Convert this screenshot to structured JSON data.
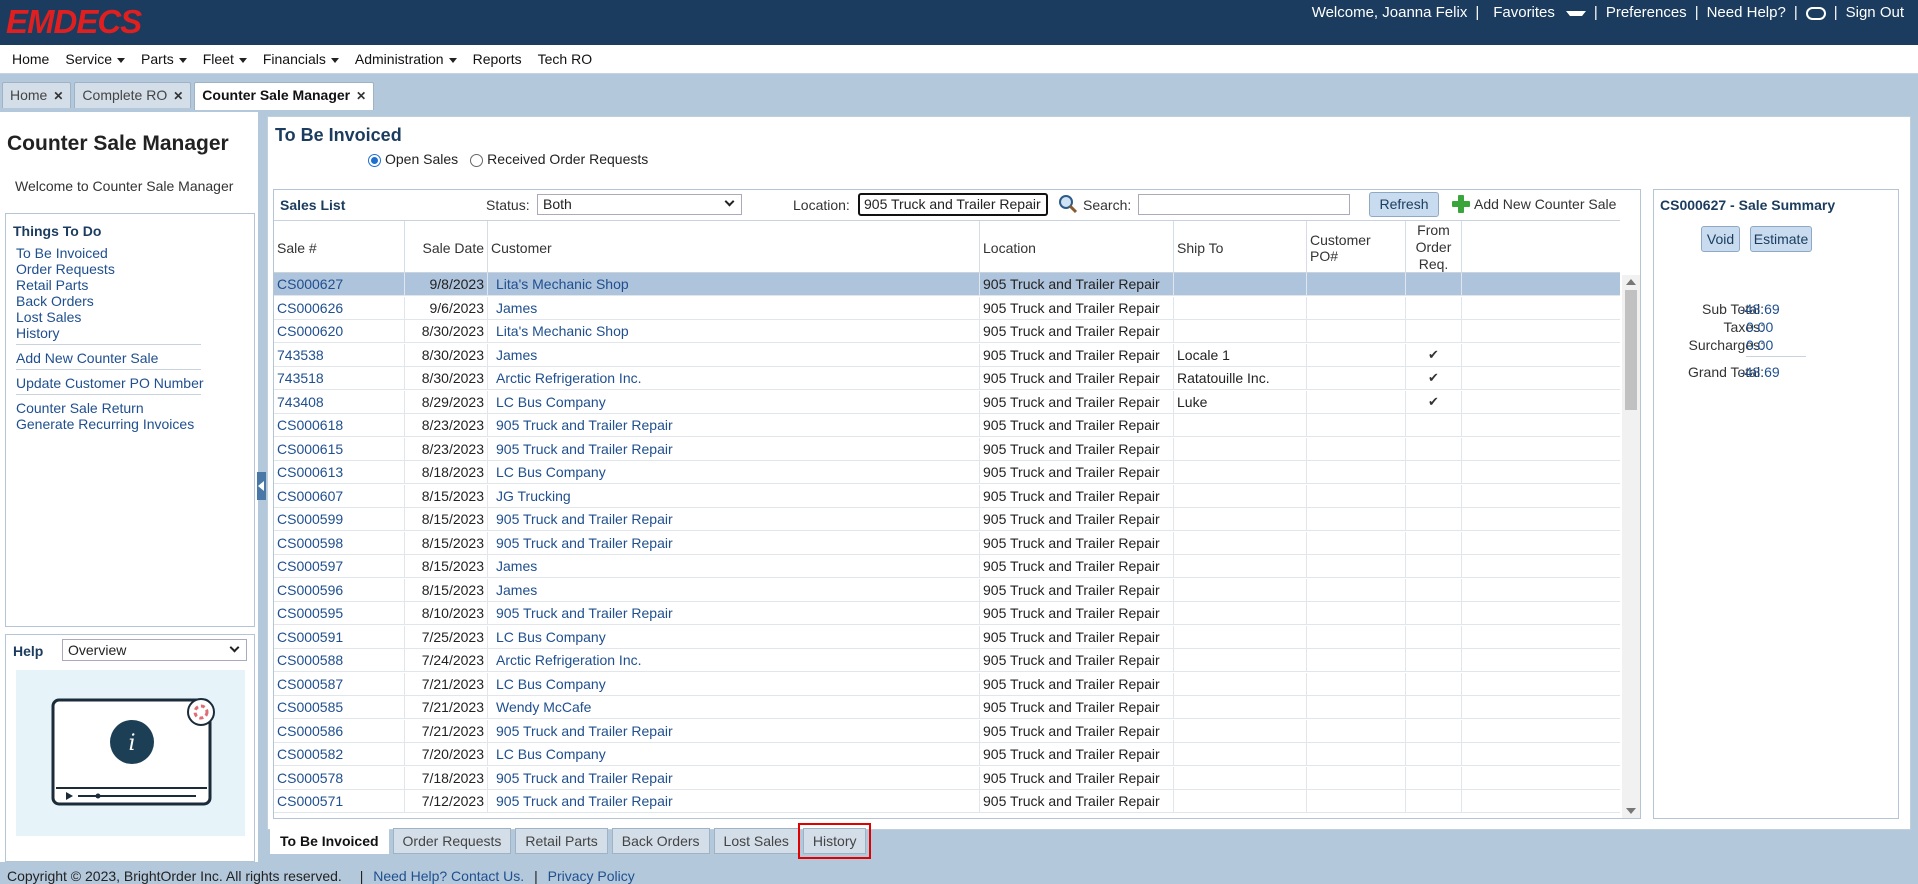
{
  "header": {
    "logo": "EMDECS",
    "welcome": "Welcome, Joanna Felix",
    "favorites": "Favorites",
    "preferences": "Preferences",
    "need_help": "Need Help?",
    "sign_out": "Sign Out"
  },
  "menu": {
    "home": "Home",
    "service": "Service",
    "parts": "Parts",
    "fleet": "Fleet",
    "financials": "Financials",
    "administration": "Administration",
    "reports": "Reports",
    "tech_ro": "Tech RO"
  },
  "tabs": {
    "t0": "Home",
    "t1": "Complete RO",
    "t2": "Counter Sale Manager"
  },
  "left": {
    "title": "Counter Sale Manager",
    "welcome": "Welcome to Counter Sale Manager",
    "todo_title": "Things To Do",
    "links": {
      "l0": "To Be Invoiced",
      "l1": "Order Requests",
      "l2": "Retail Parts",
      "l3": "Back Orders",
      "l4": "Lost Sales",
      "l5": "History",
      "l6": "Add New Counter Sale",
      "l7": "Update Customer PO Number",
      "l8": "Counter Sale Return",
      "l9": "Generate Recurring Invoices"
    },
    "help_label": "Help",
    "help_select": "Overview"
  },
  "main": {
    "title": "To Be Invoiced",
    "radio_open": "Open Sales",
    "radio_received": "Received Order Requests"
  },
  "sales_list": {
    "title": "Sales List",
    "status_label": "Status:",
    "status_value": "Both",
    "location_label": "Location:",
    "location_value": "905 Truck and Trailer Repair",
    "search_label": "Search:",
    "search_value": "",
    "refresh": "Refresh",
    "add_new": "Add New Counter Sale",
    "columns": {
      "sale": "Sale #",
      "date": "Sale Date",
      "customer": "Customer",
      "location": "Location",
      "ship_to": "Ship To",
      "po": "Customer PO#",
      "from1": "From",
      "from2": "Order",
      "from3": "Req."
    },
    "rows": [
      {
        "sale": "CS000627",
        "date": "9/8/2023",
        "customer": "Lita's Mechanic Shop",
        "location": "905 Truck and Trailer Repair",
        "ship_to": "",
        "po": "",
        "from": ""
      },
      {
        "sale": "CS000626",
        "date": "9/6/2023",
        "customer": "James",
        "location": "905 Truck and Trailer Repair",
        "ship_to": "",
        "po": "",
        "from": ""
      },
      {
        "sale": "CS000620",
        "date": "8/30/2023",
        "customer": "Lita's Mechanic Shop",
        "location": "905 Truck and Trailer Repair",
        "ship_to": "",
        "po": "",
        "from": ""
      },
      {
        "sale": "743538",
        "date": "8/30/2023",
        "customer": "James",
        "location": "905 Truck and Trailer Repair",
        "ship_to": "Locale 1",
        "po": "",
        "from": "✔"
      },
      {
        "sale": "743518",
        "date": "8/30/2023",
        "customer": "Arctic Refrigeration Inc.",
        "location": "905 Truck and Trailer Repair",
        "ship_to": "Ratatouille Inc.",
        "po": "",
        "from": "✔"
      },
      {
        "sale": "743408",
        "date": "8/29/2023",
        "customer": "LC Bus Company",
        "location": "905 Truck and Trailer Repair",
        "ship_to": "Luke",
        "po": "",
        "from": "✔"
      },
      {
        "sale": "CS000618",
        "date": "8/23/2023",
        "customer": "905 Truck and Trailer Repair",
        "location": "905 Truck and Trailer Repair",
        "ship_to": "",
        "po": "",
        "from": ""
      },
      {
        "sale": "CS000615",
        "date": "8/23/2023",
        "customer": "905 Truck and Trailer Repair",
        "location": "905 Truck and Trailer Repair",
        "ship_to": "",
        "po": "",
        "from": ""
      },
      {
        "sale": "CS000613",
        "date": "8/18/2023",
        "customer": "LC Bus Company",
        "location": "905 Truck and Trailer Repair",
        "ship_to": "",
        "po": "",
        "from": ""
      },
      {
        "sale": "CS000607",
        "date": "8/15/2023",
        "customer": "JG Trucking",
        "location": "905 Truck and Trailer Repair",
        "ship_to": "",
        "po": "",
        "from": ""
      },
      {
        "sale": "CS000599",
        "date": "8/15/2023",
        "customer": "905 Truck and Trailer Repair",
        "location": "905 Truck and Trailer Repair",
        "ship_to": "",
        "po": "",
        "from": ""
      },
      {
        "sale": "CS000598",
        "date": "8/15/2023",
        "customer": "905 Truck and Trailer Repair",
        "location": "905 Truck and Trailer Repair",
        "ship_to": "",
        "po": "",
        "from": ""
      },
      {
        "sale": "CS000597",
        "date": "8/15/2023",
        "customer": "James",
        "location": "905 Truck and Trailer Repair",
        "ship_to": "",
        "po": "",
        "from": ""
      },
      {
        "sale": "CS000596",
        "date": "8/15/2023",
        "customer": "James",
        "location": "905 Truck and Trailer Repair",
        "ship_to": "",
        "po": "",
        "from": ""
      },
      {
        "sale": "CS000595",
        "date": "8/10/2023",
        "customer": "905 Truck and Trailer Repair",
        "location": "905 Truck and Trailer Repair",
        "ship_to": "",
        "po": "",
        "from": ""
      },
      {
        "sale": "CS000591",
        "date": "7/25/2023",
        "customer": "LC Bus Company",
        "location": "905 Truck and Trailer Repair",
        "ship_to": "",
        "po": "",
        "from": ""
      },
      {
        "sale": "CS000588",
        "date": "7/24/2023",
        "customer": "Arctic Refrigeration Inc.",
        "location": "905 Truck and Trailer Repair",
        "ship_to": "",
        "po": "",
        "from": ""
      },
      {
        "sale": "CS000587",
        "date": "7/21/2023",
        "customer": "LC Bus Company",
        "location": "905 Truck and Trailer Repair",
        "ship_to": "",
        "po": "",
        "from": ""
      },
      {
        "sale": "CS000585",
        "date": "7/21/2023",
        "customer": "Wendy McCafe",
        "location": "905 Truck and Trailer Repair",
        "ship_to": "",
        "po": "",
        "from": ""
      },
      {
        "sale": "CS000586",
        "date": "7/21/2023",
        "customer": "905 Truck and Trailer Repair",
        "location": "905 Truck and Trailer Repair",
        "ship_to": "",
        "po": "",
        "from": ""
      },
      {
        "sale": "CS000582",
        "date": "7/20/2023",
        "customer": "LC Bus Company",
        "location": "905 Truck and Trailer Repair",
        "ship_to": "",
        "po": "",
        "from": ""
      },
      {
        "sale": "CS000578",
        "date": "7/18/2023",
        "customer": "905 Truck and Trailer Repair",
        "location": "905 Truck and Trailer Repair",
        "ship_to": "",
        "po": "",
        "from": ""
      },
      {
        "sale": "CS000571",
        "date": "7/12/2023",
        "customer": "905 Truck and Trailer Repair",
        "location": "905 Truck and Trailer Repair",
        "ship_to": "",
        "po": "",
        "from": ""
      }
    ]
  },
  "summary": {
    "title": "CS000627 - Sale Summary",
    "void": "Void",
    "estimate": "Estimate",
    "sub_total_label": "Sub Total:",
    "sub_total": "-48.69",
    "taxes_label": "Taxes:",
    "taxes": "0.00",
    "surcharges_label": "Surcharges:",
    "surcharges": "0.00",
    "grand_total_label": "Grand Total:",
    "grand_total": "-48.69"
  },
  "bottom_tabs": {
    "b0": "To Be Invoiced",
    "b1": "Order Requests",
    "b2": "Retail Parts",
    "b3": "Back Orders",
    "b4": "Lost Sales",
    "b5": "History"
  },
  "footer": {
    "copyright": "Copyright © 2023, BrightOrder Inc. All rights reserved.",
    "contact": "Need Help? Contact Us.",
    "privacy": "Privacy Policy"
  },
  "colors": {
    "header_bg": "#1b3c5e",
    "logo_red": "#e02020",
    "link_blue": "#1f4f8f",
    "selected_row": "#aec3dc",
    "highlight_red": "#e00000"
  }
}
